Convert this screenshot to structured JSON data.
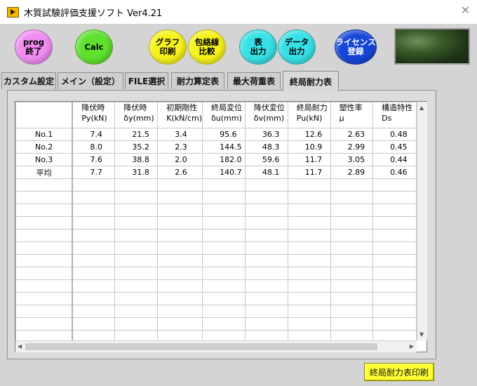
{
  "window": {
    "title": "木質試験評価支援ソフト Ver4.21",
    "close_symbol": "✕"
  },
  "toolbar": {
    "buttons": [
      {
        "label": "prog\n終了",
        "color": "#f08cf2"
      },
      {
        "label": "Calc",
        "color": "#5fe12e"
      },
      {
        "label": "グラフ\n印刷",
        "color": "#f6f21a"
      },
      {
        "label": "包絡線\n比較",
        "color": "#f6f21a"
      },
      {
        "label": "表\n出力",
        "color": "#37e0e6"
      },
      {
        "label": "データ\n出力",
        "color": "#37e0e6"
      },
      {
        "label": "ライセンス\n登録",
        "color": "#1646d8"
      }
    ]
  },
  "tabs": [
    "カスタム設定",
    "メイン（設定）",
    "FILE選択",
    "耐力算定表",
    "最大荷重表",
    "終局耐力表"
  ],
  "active_tab": "終局耐力表",
  "table": {
    "columns": [
      {
        "h1": "降伏時",
        "h2": "Py(kN)"
      },
      {
        "h1": "降伏時",
        "h2": "δy(mm)"
      },
      {
        "h1": "初期剛性",
        "h2": "K(kN/cm)"
      },
      {
        "h1": "終局変位",
        "h2": "δu(mm)"
      },
      {
        "h1": "降伏変位",
        "h2": "δv(mm)"
      },
      {
        "h1": "終局耐力",
        "h2": "Pu(kN)"
      },
      {
        "h1": "塑性率",
        "h2": "μ"
      },
      {
        "h1": "構造特性",
        "h2": "Ds"
      }
    ],
    "rows": [
      {
        "label": "No.1",
        "values": [
          "7.4",
          "21.5",
          "3.4",
          "95.6",
          "36.3",
          "12.6",
          "2.63",
          "0.48"
        ]
      },
      {
        "label": "No.2",
        "values": [
          "8.0",
          "35.2",
          "2.3",
          "144.5",
          "48.3",
          "10.9",
          "2.99",
          "0.45"
        ]
      },
      {
        "label": "No.3",
        "values": [
          "7.6",
          "38.8",
          "2.0",
          "182.0",
          "59.6",
          "11.7",
          "3.05",
          "0.44"
        ]
      },
      {
        "label": "平均",
        "values": [
          "7.7",
          "31.8",
          "2.6",
          "140.7",
          "48.1",
          "11.7",
          "2.89",
          "0.46"
        ]
      }
    ]
  },
  "print_button": {
    "label": "終局耐力表印刷"
  }
}
